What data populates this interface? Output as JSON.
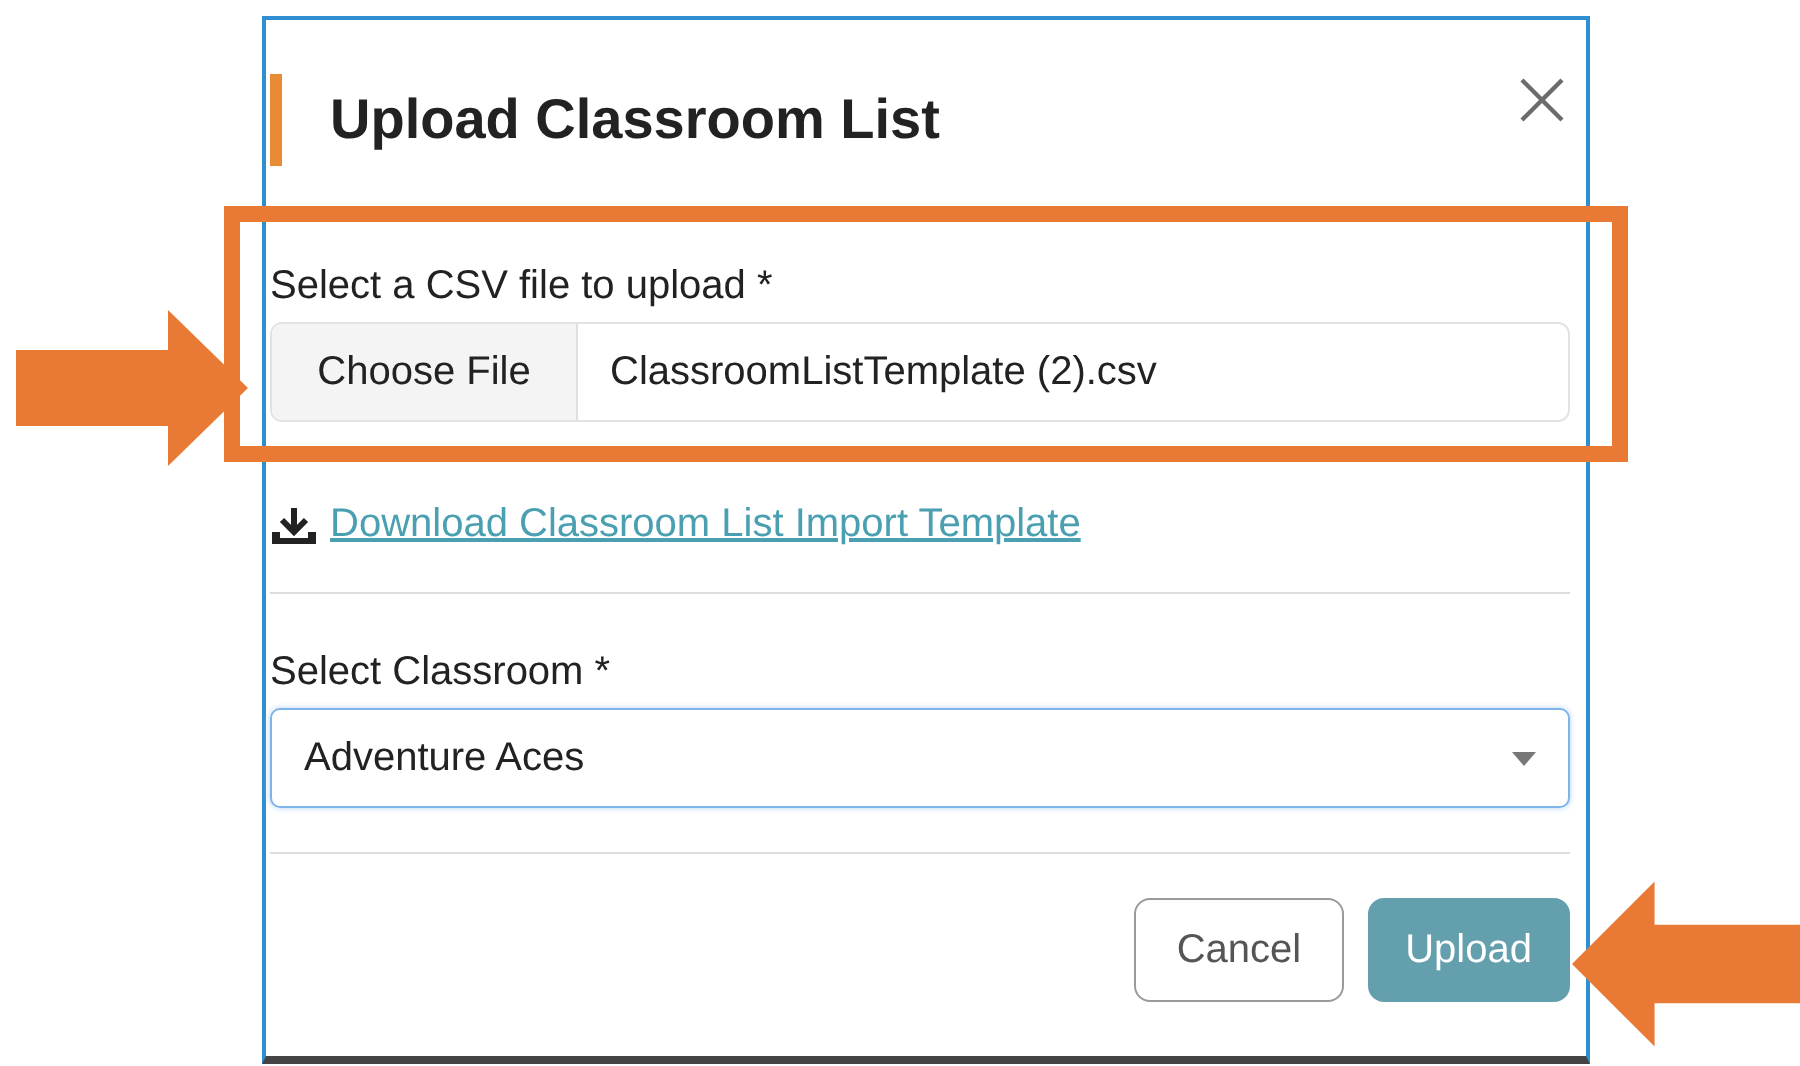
{
  "dialog": {
    "title": "Upload Classroom List",
    "file_upload": {
      "label": "Select a CSV file to upload *",
      "button": "Choose File",
      "file_name": "ClassroomListTemplate (2).csv"
    },
    "download_link": "Download Classroom List Import Template",
    "classroom": {
      "label": "Select Classroom *",
      "value": "Adventure Aces"
    },
    "buttons": [
      {
        "label": "Cancel",
        "kind": "secondary"
      },
      {
        "label": "Upload",
        "kind": "primary"
      }
    ]
  }
}
